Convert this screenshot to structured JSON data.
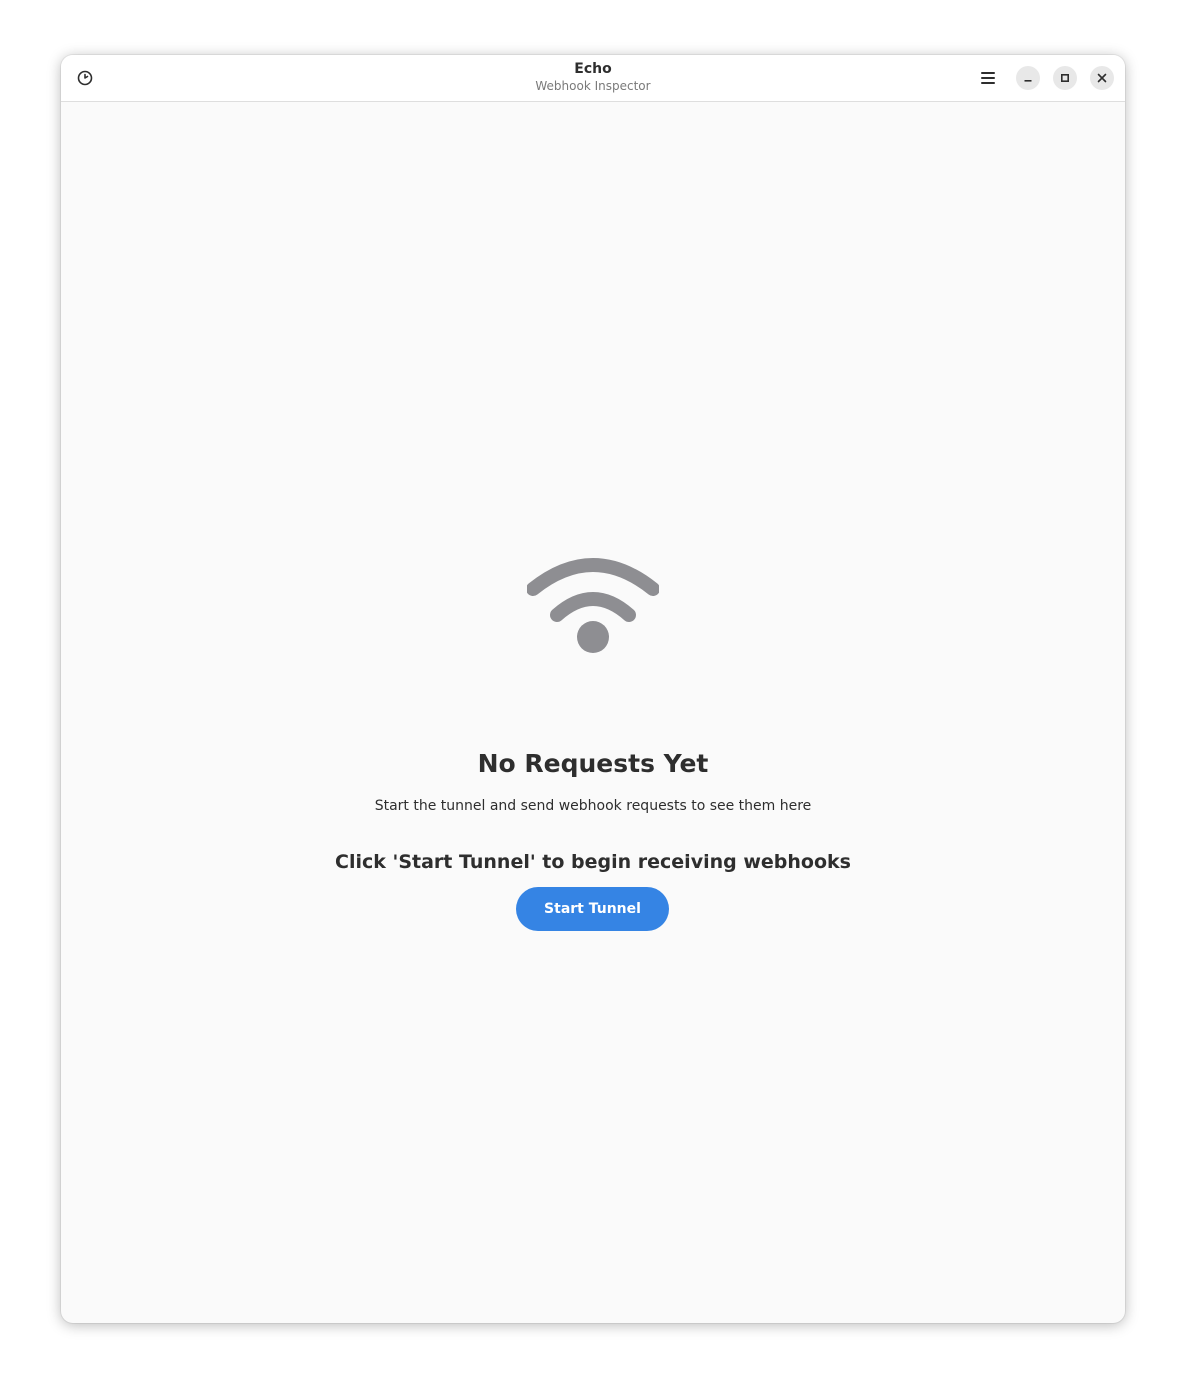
{
  "window": {
    "title": "Echo",
    "subtitle": "Webhook Inspector"
  },
  "headerbar": {
    "left_icon": "history-clock-icon",
    "menu_icon": "hamburger-menu-icon",
    "controls": [
      "minimize-icon",
      "maximize-icon",
      "close-icon"
    ]
  },
  "empty_state": {
    "icon": "wifi-signal-icon",
    "title": "No Requests Yet",
    "description": "Start the tunnel and send webhook requests to see them here",
    "hint": "Click 'Start Tunnel' to begin receiving webhooks"
  },
  "actions": {
    "start_tunnel_label": "Start Tunnel"
  },
  "colors": {
    "accent": "#3584e4",
    "icon_gray": "#8e8e92",
    "background": "#fafafa",
    "text": "#2e2e2e"
  }
}
